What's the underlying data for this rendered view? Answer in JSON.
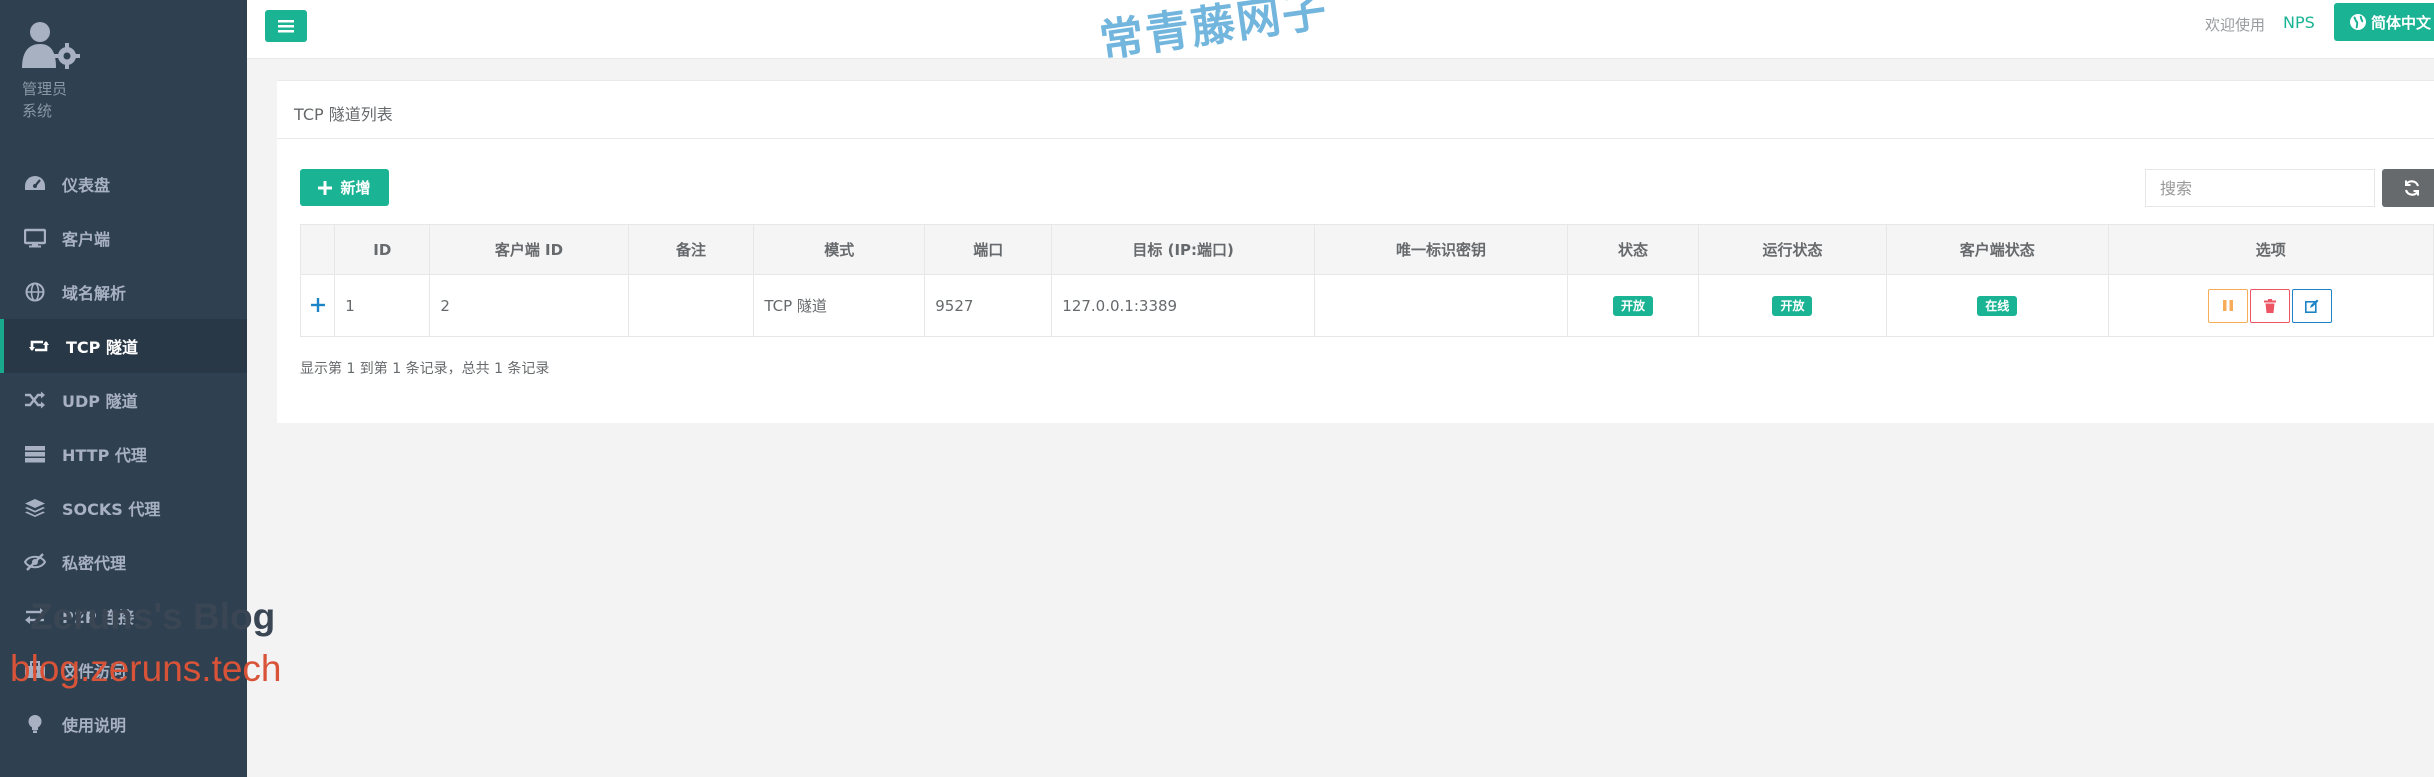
{
  "sidebar": {
    "profile": {
      "name": "管理员",
      "role": "系统"
    },
    "items": [
      {
        "label": "仪表盘",
        "icon": "dashboard-icon"
      },
      {
        "label": "客户端",
        "icon": "desktop-icon"
      },
      {
        "label": "域名解析",
        "icon": "globe-icon"
      },
      {
        "label": "TCP 隧道",
        "icon": "retweet-icon",
        "active": true
      },
      {
        "label": "UDP 隧道",
        "icon": "random-icon"
      },
      {
        "label": "HTTP 代理",
        "icon": "server-icon"
      },
      {
        "label": "SOCKS 代理",
        "icon": "layers-icon"
      },
      {
        "label": "私密代理",
        "icon": "eye-slash-icon"
      },
      {
        "label": "P2P 连接",
        "icon": "exchange-icon"
      },
      {
        "label": "文件访问",
        "icon": "briefcase-icon"
      },
      {
        "label": "使用说明",
        "icon": "lightbulb-icon"
      }
    ]
  },
  "topbar": {
    "welcome": "欢迎使用",
    "brand": "NPS",
    "language": "简体中文"
  },
  "watermarks": {
    "top": "常青藤网子",
    "blog": "Zeruns's Blog",
    "url": "blog.zeruns.tech"
  },
  "panel": {
    "title": "TCP 隧道列表",
    "add_label": "新增",
    "search_placeholder": "搜索",
    "columns": [
      "ID",
      "客户端 ID",
      "备注",
      "模式",
      "端口",
      "目标 (IP:端口)",
      "唯一标识密钥",
      "状态",
      "运行状态",
      "客户端状态",
      "选项"
    ],
    "rows": [
      {
        "id": "1",
        "client_id": "2",
        "remark": "",
        "mode": "TCP 隧道",
        "port": "9527",
        "target": "127.0.0.1:3389",
        "key": "",
        "status": "开放",
        "run_status": "开放",
        "client_status": "在线"
      }
    ],
    "pagination": "显示第 1 到第 1 条记录，总共 1 条记录"
  },
  "colors": {
    "sidebar_bg": "#2f4050",
    "primary": "#1ab394",
    "warning": "#f8ac59",
    "danger": "#ed5565",
    "info": "#1c84c6"
  }
}
